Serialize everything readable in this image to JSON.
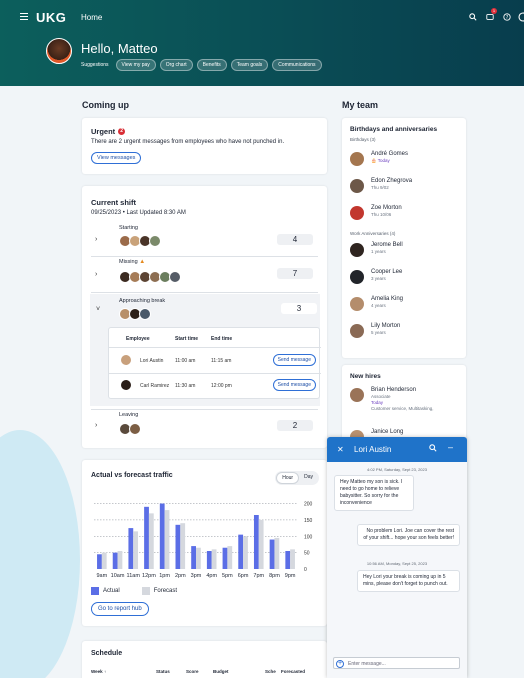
{
  "header": {
    "logo": "UKG",
    "title": "Home",
    "greeting": "Hello, Matteo",
    "suggestions_label": "Suggestions",
    "suggestions": [
      "View my pay",
      "Org chart",
      "Benefits",
      "Team goals",
      "Communications"
    ],
    "notification_count": "1"
  },
  "coming_up": {
    "heading": "Coming up",
    "urgent": {
      "title": "Urgent",
      "count": "2",
      "message": "There are 2 urgent messages from employees who have not punched in.",
      "button": "View messages"
    },
    "current_shift": {
      "title": "Current shift",
      "subtitle": "09/25/2023 • Last Updated 8:30 AM",
      "groups": [
        {
          "label": "Starting",
          "count": "4"
        },
        {
          "label": "Missing",
          "count": "7"
        },
        {
          "label": "Approaching break",
          "count": "3"
        },
        {
          "label": "Leaving",
          "count": "2"
        }
      ],
      "table": {
        "headers": [
          "Employee",
          "Start time",
          "End time"
        ],
        "rows": [
          {
            "employee": "Lori Austin",
            "start": "11:00 am",
            "end": "11:15 am",
            "action": "Send message"
          },
          {
            "employee": "Carl Ramirez",
            "start": "11:30 am",
            "end": "12:00 pm",
            "action": "Send message"
          }
        ]
      }
    },
    "traffic": {
      "title": "Actual vs forecast traffic",
      "toggle": [
        "Hour",
        "Day"
      ],
      "legend_actual": "Actual",
      "legend_forecast": "Forecast",
      "button": "Go to report hub"
    },
    "schedule": {
      "title": "Schedule",
      "headers": [
        "Week",
        "Status",
        "Score",
        "Budget",
        "Sche",
        "Forecasted"
      ]
    }
  },
  "my_team": {
    "heading": "My team",
    "birthdays": {
      "title": "Birthdays and anniversaries",
      "subtitle": "Birthdays (3)",
      "people": [
        {
          "name": "André Gomes",
          "sub": "Today"
        },
        {
          "name": "Edon Zhegrova",
          "sub": "Thu 9/02"
        },
        {
          "name": "Zoe Morton",
          "sub": "Thu 10/06"
        }
      ],
      "anniv_label": "Work Anniversaries (4)",
      "anniversaries": [
        {
          "name": "Jerome Bell",
          "sub": "1 years"
        },
        {
          "name": "Cooper Lee",
          "sub": "3 years"
        },
        {
          "name": "Amelia King",
          "sub": "4 years"
        },
        {
          "name": "Lily Morton",
          "sub": "5 years"
        }
      ]
    },
    "new_hires": {
      "title": "New hires",
      "people": [
        {
          "name": "Brian Henderson",
          "role": "Associate",
          "when": "Today",
          "dept": "Customer service, Multitasking,"
        },
        {
          "name": "Janice Long"
        }
      ]
    }
  },
  "chat": {
    "name": "Lori Austin",
    "messages": [
      {
        "time": "4:02 PM, Saturday, Sept 23, 2023",
        "text": "Hey Matteo my son is sick. I need to go home to relieve babysitter. So sorry for the inconvenience",
        "side": "left"
      },
      {
        "time": "",
        "text": "No problem Lori. Joe can cover the rest of your shift... hope your son feels better!",
        "side": "right"
      },
      {
        "time": "10:56 AM, Monday, Sept 25, 2023",
        "text": "Hey Lori your break is coming up in 5 mins, please don't forget to punch out.",
        "side": "right"
      }
    ],
    "placeholder": "Enter message..."
  },
  "chart_data": {
    "type": "bar",
    "categories": [
      "9am",
      "10am",
      "11am",
      "12pm",
      "1pm",
      "2pm",
      "3pm",
      "4pm",
      "5pm",
      "6pm",
      "7pm",
      "8pm",
      "9pm"
    ],
    "series": [
      {
        "name": "Actual",
        "values": [
          45,
          50,
          125,
          190,
          200,
          135,
          70,
          55,
          65,
          105,
          165,
          90,
          55
        ]
      },
      {
        "name": "Forecast",
        "values": [
          50,
          55,
          115,
          170,
          180,
          140,
          65,
          60,
          70,
          100,
          150,
          95,
          60
        ]
      }
    ],
    "yticks": [
      0,
      50,
      100,
      150,
      200
    ],
    "ylim": [
      0,
      220
    ],
    "colors": {
      "Actual": "#5b6ee6",
      "Forecast": "#d5d8de"
    }
  }
}
